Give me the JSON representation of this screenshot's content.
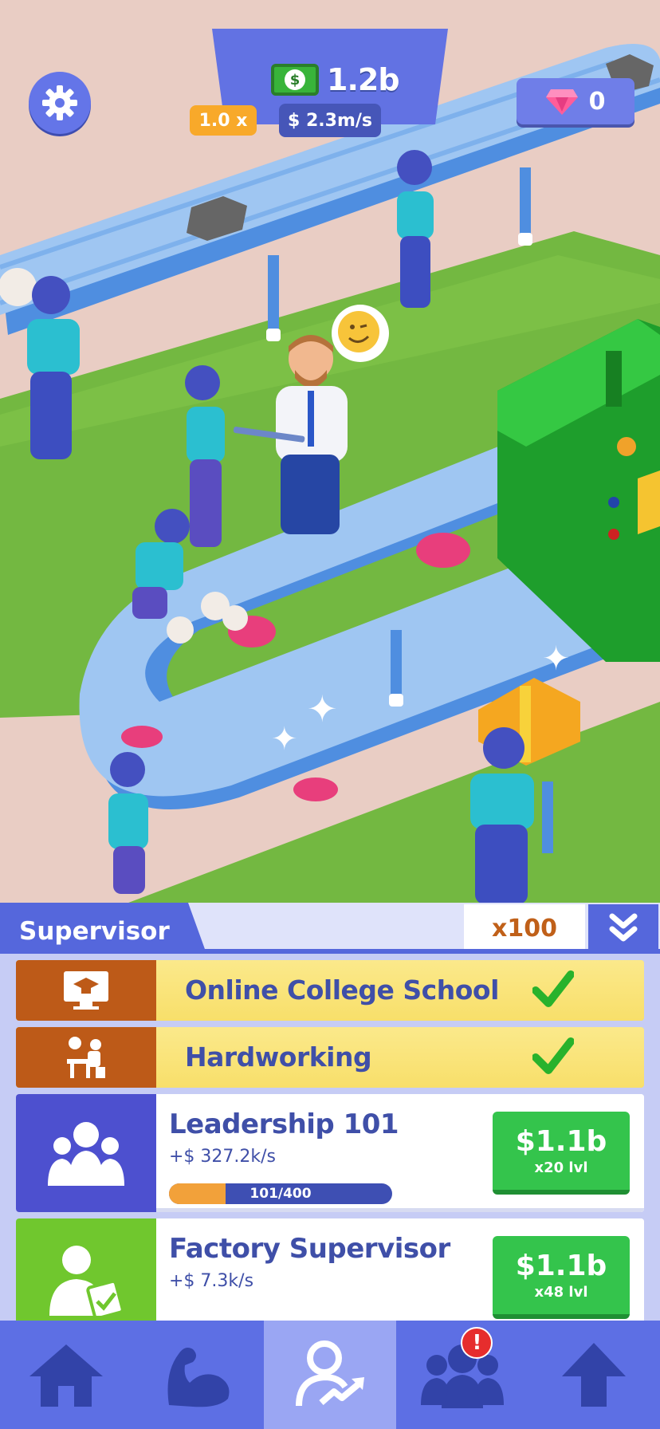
{
  "hud": {
    "money": "1.2b",
    "multiplier": "1.0 x",
    "rate": "$ 2.3m/s",
    "gems": "0",
    "settings_icon": "gear-icon"
  },
  "panel": {
    "title": "Supervisor",
    "multiplier_button": "x100",
    "collapse_icon": "double-chevron-down-icon",
    "rows": [
      {
        "title": "Online College School",
        "icon": "graduation-monitor-icon",
        "completed": true
      },
      {
        "title": "Hardworking",
        "icon": "desk-worker-icon",
        "completed": true
      },
      {
        "title": "Leadership 101",
        "icon": "team-icon",
        "income": "+$ 327.2k/s",
        "progress_label": "101/400",
        "progress": 0.2525,
        "price": "$1.1b",
        "levels": "x20 lvl"
      },
      {
        "title": "Factory Supervisor",
        "icon": "supervisor-clipboard-icon",
        "income": "+$ 7.3k/s",
        "price": "$1.1b",
        "levels": "x48 lvl"
      }
    ]
  },
  "nav": {
    "items": [
      {
        "icon": "home-icon",
        "active": false
      },
      {
        "icon": "muscle-icon",
        "active": false
      },
      {
        "icon": "manager-growth-icon",
        "active": true
      },
      {
        "icon": "team-icon",
        "active": false,
        "badge": "!"
      },
      {
        "icon": "arrow-up-icon",
        "active": false
      }
    ]
  },
  "colors": {
    "accent": "#5567dc",
    "buy_green": "#34c44c",
    "gold": "#f8a92a",
    "completed_row": "#f7d85c",
    "completed_icon_bg": "#bd5a18"
  }
}
